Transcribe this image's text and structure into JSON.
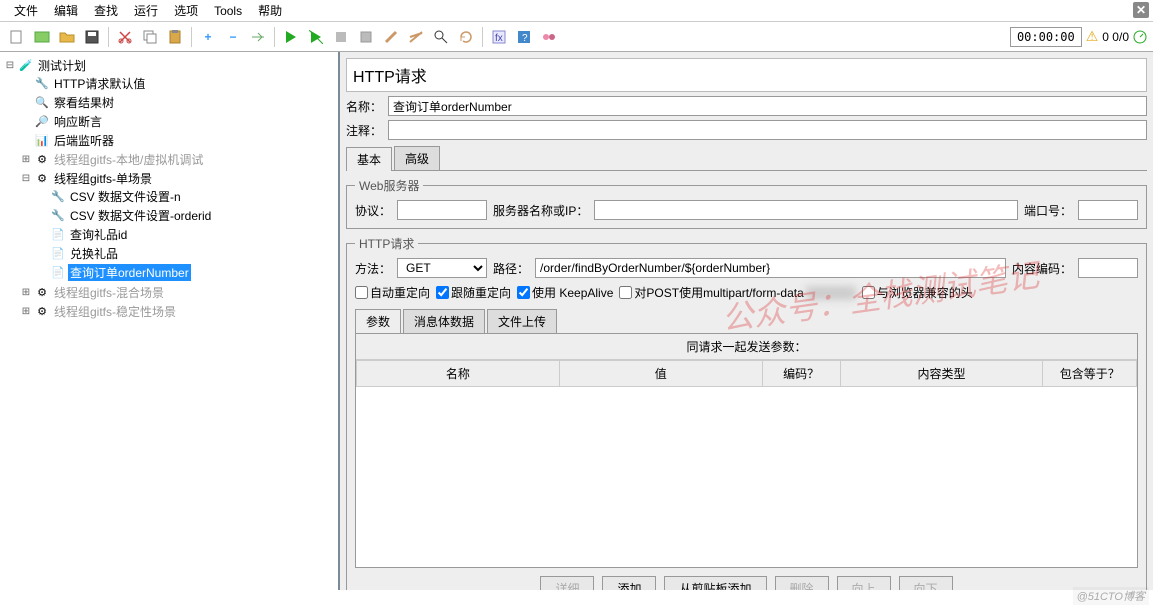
{
  "menu": {
    "items": [
      "文件",
      "编辑",
      "查找",
      "运行",
      "选项",
      "Tools",
      "帮助"
    ]
  },
  "toolbar": {
    "timer": "00:00:00",
    "counter": "0  0/0",
    "icons": [
      "new-icon",
      "open-icon-tpl",
      "open-icon",
      "save-icon",
      "cut-icon",
      "copy-icon",
      "paste-icon",
      "plus-icon",
      "minus-icon",
      "wand-icon",
      "run-icon",
      "run-nohup-icon",
      "stop-icon",
      "stop-all-icon",
      "clear-icon",
      "clear-all-icon",
      "search-icon",
      "func-icon",
      "help-icon",
      "threads-icon"
    ]
  },
  "tree": {
    "root": "测试计划",
    "items": [
      {
        "icon": "wrench",
        "label": "HTTP请求默认值"
      },
      {
        "icon": "eye",
        "label": "察看结果树"
      },
      {
        "icon": "assert",
        "label": "响应断言"
      },
      {
        "icon": "listener",
        "label": "后端监听器"
      }
    ],
    "groups": [
      {
        "icon": "gear",
        "label": "线程组gitfs-本地/虚拟机调试",
        "disabled": true,
        "expanded": false
      },
      {
        "icon": "gear",
        "label": "线程组gitfs-单场景",
        "disabled": false,
        "expanded": true,
        "children": [
          {
            "icon": "wrench",
            "label": "CSV 数据文件设置-n"
          },
          {
            "icon": "wrench",
            "label": "CSV 数据文件设置-orderid"
          },
          {
            "icon": "http",
            "label": "查询礼品id"
          },
          {
            "icon": "http",
            "label": "兑换礼品"
          },
          {
            "icon": "http",
            "label": "查询订单orderNumber",
            "selected": true
          }
        ]
      },
      {
        "icon": "gear",
        "label": "线程组gitfs-混合场景",
        "disabled": true,
        "expanded": false
      },
      {
        "icon": "gear",
        "label": "线程组gitfs-稳定性场景",
        "disabled": true,
        "expanded": false
      }
    ]
  },
  "form": {
    "title": "HTTP请求",
    "name_label": "名称：",
    "name_value": "查询订单orderNumber",
    "comment_label": "注释：",
    "comment_value": "",
    "tabs": {
      "basic": "基本",
      "advanced": "高级"
    },
    "web_server": {
      "legend": "Web服务器",
      "protocol_label": "协议：",
      "protocol_value": "",
      "server_label": "服务器名称或IP：",
      "server_value": "",
      "port_label": "端口号：",
      "port_value": ""
    },
    "http_request": {
      "legend": "HTTP请求",
      "method_label": "方法：",
      "method_value": "GET",
      "path_label": "路径：",
      "path_value": "/order/findByOrderNumber/${orderNumber}",
      "encoding_label": "内容编码：",
      "encoding_value": "",
      "auto_redirect": "自动重定向",
      "follow_redirect": "跟随重定向",
      "keepalive": "使用 KeepAlive",
      "multipart": "对POST使用multipart/form-data",
      "browser_headers": "与浏览器兼容的头"
    },
    "param_tabs": {
      "params": "参数",
      "body": "消息体数据",
      "upload": "文件上传"
    },
    "param_header": "同请求一起发送参数：",
    "table_cols": {
      "name": "名称",
      "value": "值",
      "encode": "编码？",
      "type": "内容类型",
      "equals": "包含等于？"
    },
    "buttons": {
      "detail": "详细",
      "add": "添加",
      "clipboard": "从剪贴板添加",
      "delete": "删除",
      "up": "向上",
      "down": "向下"
    }
  },
  "watermark": "公众号：全栈测试笔记",
  "credit": "@51CTO博客"
}
